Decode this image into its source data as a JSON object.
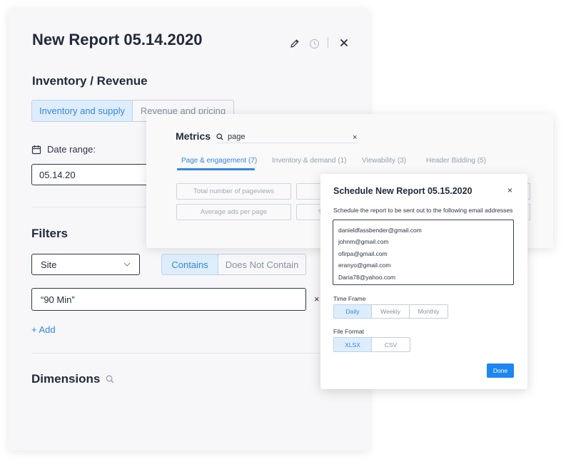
{
  "report": {
    "title": "New Report 05.14.2020",
    "section_title": "Inventory / Revenue",
    "tabs": [
      {
        "label": "Inventory and supply",
        "active": true
      },
      {
        "label": "Revenue and pricing",
        "active": false
      }
    ],
    "date_range_label": "Date range:",
    "date_value": "05.14.20",
    "filters_title": "Filters",
    "filter_dimension": "Site",
    "match_tabs": [
      {
        "label": "Contains",
        "active": true
      },
      {
        "label": "Does Not Contain",
        "active": false
      }
    ],
    "filter_value": "“90 Min”",
    "filter_clear": "×",
    "add_label": "+ Add",
    "dimensions_title": "Dimensions"
  },
  "metrics": {
    "title": "Metrics",
    "search_value": "page",
    "search_clear": "×",
    "tabs": [
      {
        "label": "Page & engagement (7)",
        "active": true
      },
      {
        "label": "Inventory & demand (1)",
        "active": false
      },
      {
        "label": "Viewability (3)",
        "active": false
      },
      {
        "label": "Header Bidding (5)",
        "active": false
      }
    ],
    "cards": [
      "Total number of pageviews",
      "Average ads per page",
      "",
      "%"
    ]
  },
  "schedule": {
    "title": "Schedule New Report 05.15.2020",
    "close": "×",
    "description": "Schedule the report to be sent out to the following email addresses",
    "emails": [
      "danieldfassbender@gmail.com",
      "johnm@gmail.com",
      "ofirpa@gmail.com",
      "eranyo@gmail.com",
      "Daria78@yahoo.com"
    ],
    "time_frame_label": "Time Frame",
    "time_frames": [
      {
        "label": "Daily",
        "active": true
      },
      {
        "label": "Weekly",
        "active": false
      },
      {
        "label": "Monthly",
        "active": false
      }
    ],
    "file_format_label": "File Format",
    "file_formats": [
      {
        "label": "XLSX",
        "active": true
      },
      {
        "label": "CSV",
        "active": false
      }
    ],
    "done_label": "Done"
  },
  "colors": {
    "accent": "#3487dd",
    "active_tab_bg": "#deedfb",
    "primary_button": "#1c86f2"
  },
  "icons": [
    "edit-icon",
    "history-icon",
    "close-icon",
    "calendar-icon",
    "chevron-down-icon",
    "search-icon"
  ]
}
